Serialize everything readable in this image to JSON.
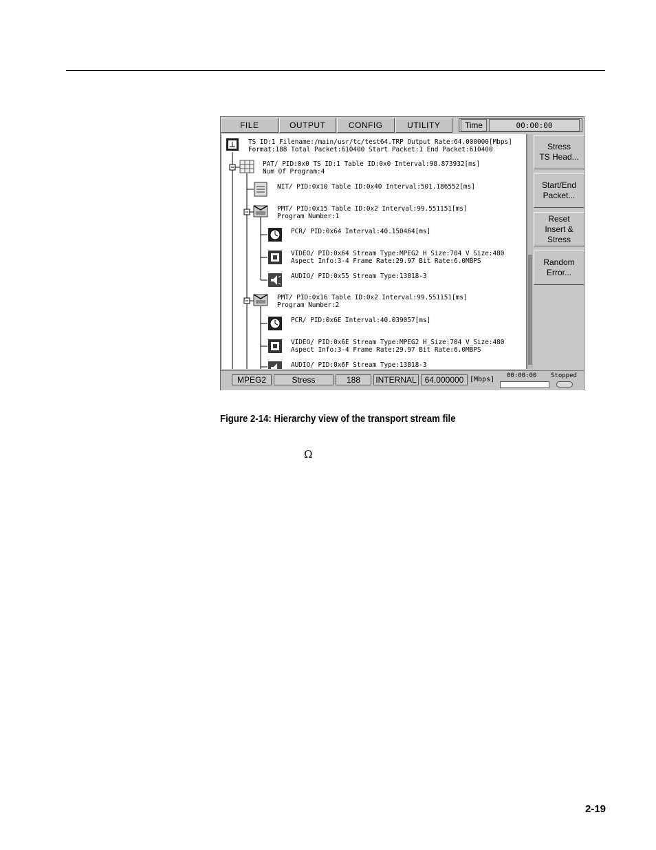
{
  "menu": {
    "items": [
      "FILE",
      "OUTPUT",
      "CONFIG",
      "UTILITY"
    ]
  },
  "time": {
    "label": "Time",
    "value": "00:00:00"
  },
  "tree": {
    "ts": [
      "TS ID:1  Filename:/main/usr/tc/test64.TRP  Output Rate:64.000000[Mbps]",
      "Format:188  Total Packet:610400  Start Packet:1  End Packet:610400"
    ],
    "pat": [
      "PAT/  PID:0x0  TS ID:1  Table ID:0x0  Interval:98.873932[ms]",
      "Num Of Program:4"
    ],
    "nit": "NIT/  PID:0x10  Table ID:0x40  Interval:501.186552[ms]",
    "pmt1": [
      "PMT/  PID:0x15  Table ID:0x2  Interval:99.551151[ms]",
      "Program Number:1"
    ],
    "pcr1": "PCR/  PID:0x64  Interval:40.150464[ms]",
    "video1": [
      "VIDEO/  PID:0x64  Stream Type:MPEG2    H_Size:704  V_Size:480",
      "Aspect Info:3-4  Frame Rate:29.97  Bit Rate:6.0MBPS"
    ],
    "audio1": "AUDIO/  PID:0x55  Stream Type:13818-3",
    "pmt2": [
      "PMT/  PID:0x16  Table ID:0x2  Interval:99.551151[ms]",
      "Program Number:2"
    ],
    "pcr2": "PCR/  PID:0x6E  Interval:40.039057[ms]",
    "video2": [
      "VIDEO/  PID:0x6E  Stream Type:MPEG2    H_Size:704  V_Size:480",
      "Aspect Info:3-4  Frame Rate:29.97  Bit Rate:6.0MBPS"
    ],
    "audio2": "AUDIO/  PID:0x6F  Stream Type:13818-3"
  },
  "softkeys": [
    "Stress\nTS Head...",
    "Start/End\nPacket...",
    "Reset\nInsert &\nStress",
    "Random\nError..."
  ],
  "status": {
    "format": "MPEG2",
    "mode": "Stress",
    "packet": "188",
    "clock": "INTERNAL",
    "rate": "64.000000",
    "unit": "[Mbps]",
    "time": "00:00:00",
    "state": "Stopped"
  },
  "caption": "Figure 2-14: Hierarchy view of the transport stream file",
  "symbol": "Ω",
  "page_number": "2-19"
}
